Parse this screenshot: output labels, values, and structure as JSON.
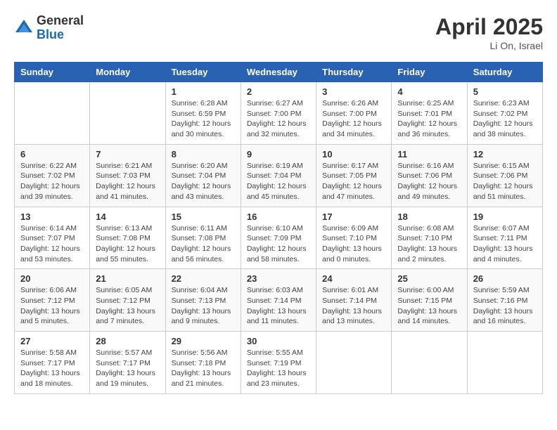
{
  "logo": {
    "general": "General",
    "blue": "Blue"
  },
  "title": "April 2025",
  "location": "Li On, Israel",
  "days_of_week": [
    "Sunday",
    "Monday",
    "Tuesday",
    "Wednesday",
    "Thursday",
    "Friday",
    "Saturday"
  ],
  "weeks": [
    [
      {
        "day": null,
        "info": null
      },
      {
        "day": null,
        "info": null
      },
      {
        "day": "1",
        "info": "Sunrise: 6:28 AM\nSunset: 6:59 PM\nDaylight: 12 hours\nand 30 minutes."
      },
      {
        "day": "2",
        "info": "Sunrise: 6:27 AM\nSunset: 7:00 PM\nDaylight: 12 hours\nand 32 minutes."
      },
      {
        "day": "3",
        "info": "Sunrise: 6:26 AM\nSunset: 7:00 PM\nDaylight: 12 hours\nand 34 minutes."
      },
      {
        "day": "4",
        "info": "Sunrise: 6:25 AM\nSunset: 7:01 PM\nDaylight: 12 hours\nand 36 minutes."
      },
      {
        "day": "5",
        "info": "Sunrise: 6:23 AM\nSunset: 7:02 PM\nDaylight: 12 hours\nand 38 minutes."
      }
    ],
    [
      {
        "day": "6",
        "info": "Sunrise: 6:22 AM\nSunset: 7:02 PM\nDaylight: 12 hours\nand 39 minutes."
      },
      {
        "day": "7",
        "info": "Sunrise: 6:21 AM\nSunset: 7:03 PM\nDaylight: 12 hours\nand 41 minutes."
      },
      {
        "day": "8",
        "info": "Sunrise: 6:20 AM\nSunset: 7:04 PM\nDaylight: 12 hours\nand 43 minutes."
      },
      {
        "day": "9",
        "info": "Sunrise: 6:19 AM\nSunset: 7:04 PM\nDaylight: 12 hours\nand 45 minutes."
      },
      {
        "day": "10",
        "info": "Sunrise: 6:17 AM\nSunset: 7:05 PM\nDaylight: 12 hours\nand 47 minutes."
      },
      {
        "day": "11",
        "info": "Sunrise: 6:16 AM\nSunset: 7:06 PM\nDaylight: 12 hours\nand 49 minutes."
      },
      {
        "day": "12",
        "info": "Sunrise: 6:15 AM\nSunset: 7:06 PM\nDaylight: 12 hours\nand 51 minutes."
      }
    ],
    [
      {
        "day": "13",
        "info": "Sunrise: 6:14 AM\nSunset: 7:07 PM\nDaylight: 12 hours\nand 53 minutes."
      },
      {
        "day": "14",
        "info": "Sunrise: 6:13 AM\nSunset: 7:08 PM\nDaylight: 12 hours\nand 55 minutes."
      },
      {
        "day": "15",
        "info": "Sunrise: 6:11 AM\nSunset: 7:08 PM\nDaylight: 12 hours\nand 56 minutes."
      },
      {
        "day": "16",
        "info": "Sunrise: 6:10 AM\nSunset: 7:09 PM\nDaylight: 12 hours\nand 58 minutes."
      },
      {
        "day": "17",
        "info": "Sunrise: 6:09 AM\nSunset: 7:10 PM\nDaylight: 13 hours\nand 0 minutes."
      },
      {
        "day": "18",
        "info": "Sunrise: 6:08 AM\nSunset: 7:10 PM\nDaylight: 13 hours\nand 2 minutes."
      },
      {
        "day": "19",
        "info": "Sunrise: 6:07 AM\nSunset: 7:11 PM\nDaylight: 13 hours\nand 4 minutes."
      }
    ],
    [
      {
        "day": "20",
        "info": "Sunrise: 6:06 AM\nSunset: 7:12 PM\nDaylight: 13 hours\nand 5 minutes."
      },
      {
        "day": "21",
        "info": "Sunrise: 6:05 AM\nSunset: 7:12 PM\nDaylight: 13 hours\nand 7 minutes."
      },
      {
        "day": "22",
        "info": "Sunrise: 6:04 AM\nSunset: 7:13 PM\nDaylight: 13 hours\nand 9 minutes."
      },
      {
        "day": "23",
        "info": "Sunrise: 6:03 AM\nSunset: 7:14 PM\nDaylight: 13 hours\nand 11 minutes."
      },
      {
        "day": "24",
        "info": "Sunrise: 6:01 AM\nSunset: 7:14 PM\nDaylight: 13 hours\nand 13 minutes."
      },
      {
        "day": "25",
        "info": "Sunrise: 6:00 AM\nSunset: 7:15 PM\nDaylight: 13 hours\nand 14 minutes."
      },
      {
        "day": "26",
        "info": "Sunrise: 5:59 AM\nSunset: 7:16 PM\nDaylight: 13 hours\nand 16 minutes."
      }
    ],
    [
      {
        "day": "27",
        "info": "Sunrise: 5:58 AM\nSunset: 7:17 PM\nDaylight: 13 hours\nand 18 minutes."
      },
      {
        "day": "28",
        "info": "Sunrise: 5:57 AM\nSunset: 7:17 PM\nDaylight: 13 hours\nand 19 minutes."
      },
      {
        "day": "29",
        "info": "Sunrise: 5:56 AM\nSunset: 7:18 PM\nDaylight: 13 hours\nand 21 minutes."
      },
      {
        "day": "30",
        "info": "Sunrise: 5:55 AM\nSunset: 7:19 PM\nDaylight: 13 hours\nand 23 minutes."
      },
      {
        "day": null,
        "info": null
      },
      {
        "day": null,
        "info": null
      },
      {
        "day": null,
        "info": null
      }
    ]
  ]
}
